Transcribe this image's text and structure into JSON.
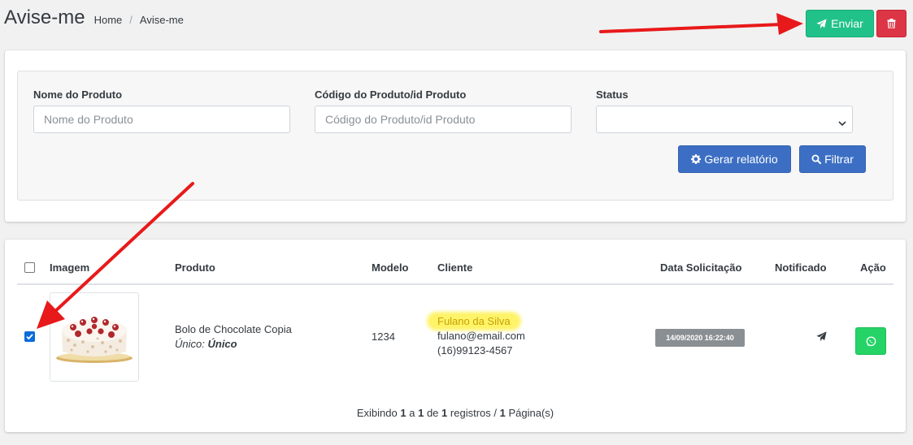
{
  "header": {
    "title": "Avise-me",
    "breadcrumb": {
      "home": "Home",
      "separator": "/",
      "current": "Avise-me"
    }
  },
  "toolbar": {
    "send_label": "Enviar",
    "send_icon": "paper-plane-icon",
    "delete_icon": "trash-icon"
  },
  "filters": {
    "product_name": {
      "label": "Nome do Produto",
      "placeholder": "Nome do Produto",
      "value": ""
    },
    "product_code": {
      "label": "Código do Produto/id Produto",
      "placeholder": "Código do Produto/id Produto",
      "value": ""
    },
    "status": {
      "label": "Status",
      "selected": ""
    },
    "report_button": "Gerar relatório",
    "filter_button": "Filtrar"
  },
  "table": {
    "columns": {
      "image": "Imagem",
      "product": "Produto",
      "model": "Modelo",
      "client": "Cliente",
      "request_date": "Data Solicitação",
      "notified": "Notificado",
      "action": "Ação"
    },
    "select_all_checked": false,
    "rows": [
      {
        "checked": true,
        "image": "cake-image",
        "product_name": "Bolo de Chocolate Copia",
        "option_label": "Único:",
        "option_value": "Único",
        "model": "1234",
        "client_name": "Fulano da Silva",
        "client_email": "fulano@email.com",
        "client_phone": "(16)99123-4567",
        "request_date": "14/09/2020 16:22:40",
        "notified_icon": "paper-plane-icon",
        "action_icon": "whatsapp-icon"
      }
    ]
  },
  "pagination": {
    "prefix": "Exibindo",
    "from": "1",
    "a": "a",
    "to": "1",
    "de": "de",
    "total": "1",
    "registros": "registros /",
    "pages": "1",
    "pages_label": "Página(s)"
  },
  "colors": {
    "send": "#20c28a",
    "delete": "#dc3545",
    "primary": "#3c6fc4",
    "whatsapp": "#25d366",
    "annotation_arrow": "#e8191a",
    "highlight": "#fff36a"
  }
}
